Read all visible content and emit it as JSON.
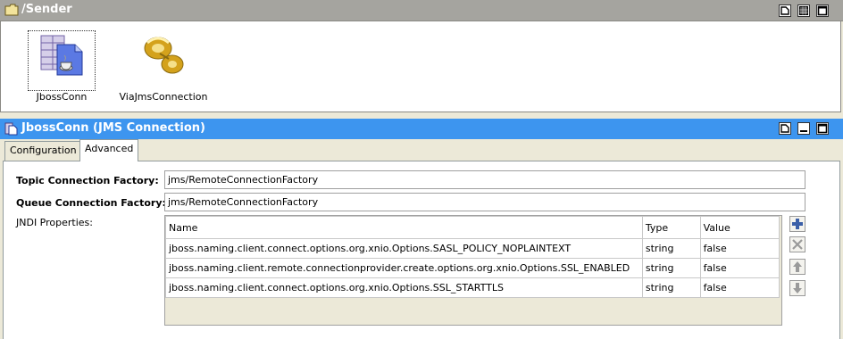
{
  "sender_panel": {
    "title": "/Sender",
    "nodes": [
      {
        "label": "JbossConn",
        "selected": true
      },
      {
        "label": "ViaJmsConnection",
        "selected": false
      }
    ]
  },
  "conn_panel": {
    "title": "JbossConn (JMS Connection)",
    "tabs": [
      "Configuration",
      "Advanced"
    ],
    "active_tab": "Advanced"
  },
  "advanced": {
    "topic_label": "Topic Connection Factory:",
    "topic_value": "jms/RemoteConnectionFactory",
    "queue_label": "Queue Connection Factory:",
    "queue_value": "jms/RemoteConnectionFactory",
    "jndi_label": "JNDI Properties:",
    "table": {
      "headers": [
        "Name",
        "Type",
        "Value"
      ],
      "rows": [
        [
          "jboss.naming.client.connect.options.org.xnio.Options.SASL_POLICY_NOPLAINTEXT",
          "string",
          "false"
        ],
        [
          "jboss.naming.client.remote.connectionprovider.create.options.org.xnio.Options.SSL_ENABLED",
          "string",
          "false"
        ],
        [
          "jboss.naming.client.connect.options.org.xnio.Options.SSL_STARTTLS",
          "string",
          "false"
        ]
      ]
    }
  },
  "colors": {
    "active_title": "#3d95ef",
    "inactive_title": "#a5a49f",
    "add_icon": "#3b5fa8"
  }
}
